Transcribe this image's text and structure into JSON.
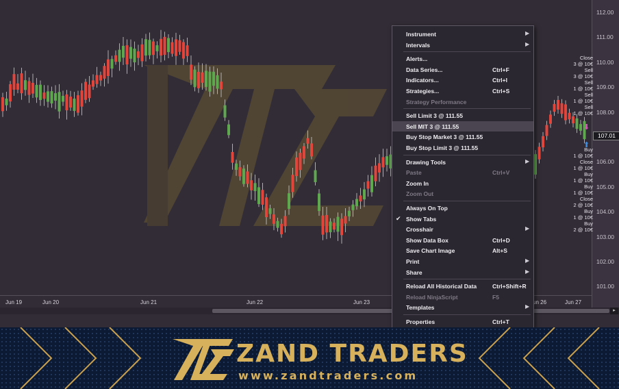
{
  "chart": {
    "price_axis": [
      "112.00",
      "111.00",
      "110.00",
      "109.00",
      "108.00",
      "107.00",
      "106.00",
      "105.00",
      "104.00",
      "103.00",
      "102.00",
      "101.00"
    ],
    "current_price": "107.01",
    "time_axis": [
      "Jun 19",
      "Jun 20",
      "Jun 21",
      "Jun 22",
      "Jun 23",
      "Jun 26",
      "Jun 27"
    ],
    "order_labels": [
      [
        "Close",
        "3 @ 10€"
      ],
      [
        "Sell",
        "3 @ 10€"
      ],
      [
        "Sell",
        "1 @ 10€"
      ],
      [
        "Sell",
        "1 @ 10€"
      ],
      [
        "Sell",
        "1 @ 10€"
      ],
      [
        "Buy",
        "1 @ 10€"
      ],
      [
        "Close",
        "1 @ 10€"
      ],
      [
        "Buy",
        "1 @ 10€"
      ],
      [
        "Buy",
        "1 @ 10€"
      ],
      [
        "Close",
        "2 @ 10€"
      ],
      [
        "Buy",
        "1 @ 10€"
      ],
      [
        "Buy",
        "2 @ 10€"
      ]
    ],
    "colors": {
      "up": "#5fa84f",
      "down": "#e0463c",
      "background": "#322c36"
    }
  },
  "context_menu": {
    "items": [
      {
        "label": "Instrument",
        "shortcut": "",
        "submenu": true,
        "disabled": false
      },
      {
        "label": "Intervals",
        "shortcut": "",
        "submenu": true,
        "disabled": false
      },
      {
        "sep": true
      },
      {
        "label": "Alerts...",
        "shortcut": "",
        "submenu": false,
        "disabled": false
      },
      {
        "label": "Data Series...",
        "shortcut": "Ctrl+F",
        "submenu": false,
        "disabled": false
      },
      {
        "label": "Indicators...",
        "shortcut": "Ctrl+I",
        "submenu": false,
        "disabled": false
      },
      {
        "label": "Strategies...",
        "shortcut": "Ctrl+S",
        "submenu": false,
        "disabled": false
      },
      {
        "label": "Strategy Performance",
        "shortcut": "",
        "submenu": false,
        "disabled": true
      },
      {
        "sep": true
      },
      {
        "label": "Sell Limit 3 @ 111.55",
        "shortcut": "",
        "submenu": false,
        "disabled": false
      },
      {
        "label": "Sell MIT 3 @ 111.55",
        "shortcut": "",
        "submenu": false,
        "disabled": false,
        "highlight": true
      },
      {
        "label": "Buy Stop Market 3 @ 111.55",
        "shortcut": "",
        "submenu": false,
        "disabled": false
      },
      {
        "label": "Buy Stop Limit 3 @ 111.55",
        "shortcut": "",
        "submenu": false,
        "disabled": false
      },
      {
        "sep": true
      },
      {
        "label": "Drawing Tools",
        "shortcut": "",
        "submenu": true,
        "disabled": false
      },
      {
        "label": "Paste",
        "shortcut": "Ctrl+V",
        "submenu": false,
        "disabled": true
      },
      {
        "label": "Zoom In",
        "shortcut": "",
        "submenu": false,
        "disabled": false
      },
      {
        "label": "Zoom Out",
        "shortcut": "",
        "submenu": false,
        "disabled": true
      },
      {
        "sep": true
      },
      {
        "label": "Always On Top",
        "shortcut": "",
        "submenu": false,
        "disabled": false
      },
      {
        "label": "Show Tabs",
        "shortcut": "",
        "submenu": false,
        "disabled": false,
        "checked": true
      },
      {
        "label": "Crosshair",
        "shortcut": "",
        "submenu": true,
        "disabled": false
      },
      {
        "label": "Show Data Box",
        "shortcut": "Ctrl+D",
        "submenu": false,
        "disabled": false
      },
      {
        "label": "Save Chart Image",
        "shortcut": "Alt+S",
        "submenu": false,
        "disabled": false
      },
      {
        "label": "Print",
        "shortcut": "",
        "submenu": true,
        "disabled": false
      },
      {
        "label": "Share",
        "shortcut": "",
        "submenu": true,
        "disabled": false
      },
      {
        "sep": true
      },
      {
        "label": "Reload All Historical Data",
        "shortcut": "Ctrl+Shift+R",
        "submenu": false,
        "disabled": false
      },
      {
        "label": "Reload NinjaScript",
        "shortcut": "F5",
        "submenu": false,
        "disabled": true
      },
      {
        "label": "Templates",
        "shortcut": "",
        "submenu": true,
        "disabled": false
      },
      {
        "sep": true
      },
      {
        "label": "Properties",
        "shortcut": "Ctrl+T",
        "submenu": false,
        "disabled": false
      }
    ]
  },
  "banner": {
    "brand": "ZAND TRADERS",
    "url": "www.zandtraders.com",
    "gold": "#d8b15c",
    "navy": "#0c1a33"
  }
}
